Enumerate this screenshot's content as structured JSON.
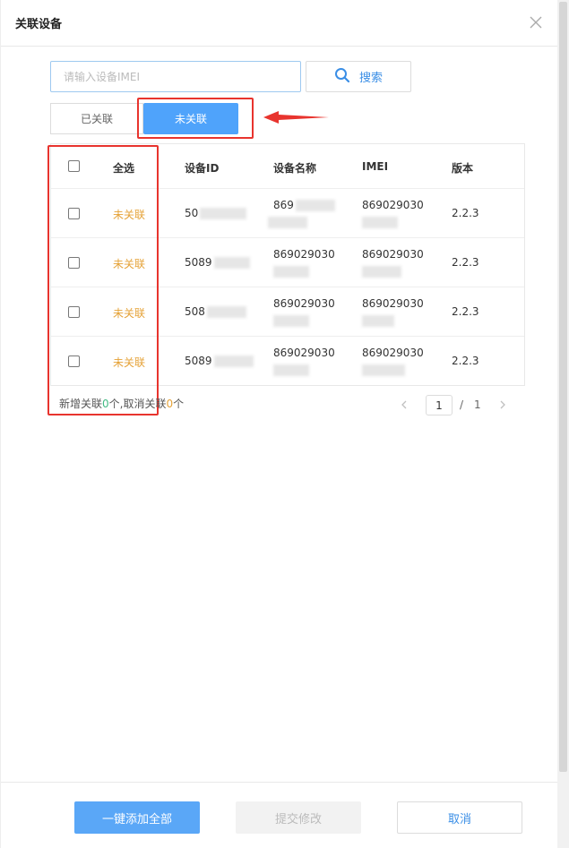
{
  "dialog": {
    "title": "关联设备"
  },
  "search": {
    "placeholder": "请输入设备IMEI",
    "button_label": "搜索"
  },
  "tabs": [
    {
      "label": "已关联",
      "active": false
    },
    {
      "label": "未关联",
      "active": true
    }
  ],
  "table": {
    "headers": {
      "select_all": "全选",
      "device_id": "设备ID",
      "device_name": "设备名称",
      "imei": "IMEI",
      "version": "版本"
    },
    "rows": [
      {
        "status": "未关联",
        "device_id": "50",
        "device_name": "869",
        "imei": "869029030",
        "version": "2.2.3"
      },
      {
        "status": "未关联",
        "device_id": "5089",
        "device_name": "869029030",
        "imei": "869029030",
        "version": "2.2.3"
      },
      {
        "status": "未关联",
        "device_id": "508",
        "device_name": "869029030",
        "imei": "869029030",
        "version": "2.2.3"
      },
      {
        "status": "未关联",
        "device_id": "5089",
        "device_name": "869029030",
        "imei": "869029030",
        "version": "2.2.3"
      }
    ]
  },
  "summary": {
    "prefix": "新增关联",
    "added_count": "0",
    "middle": "个,取消关联",
    "removed_count": "0",
    "suffix": "个"
  },
  "pagination": {
    "current": "1",
    "separator": "/",
    "total": "1"
  },
  "footer": {
    "add_all_label": "一键添加全部",
    "submit_label": "提交修改",
    "cancel_label": "取消"
  },
  "colors": {
    "primary": "#4fa3fb",
    "status_unlinked": "#e5a237",
    "count_added": "#42b983",
    "highlight": "#e8342e"
  }
}
